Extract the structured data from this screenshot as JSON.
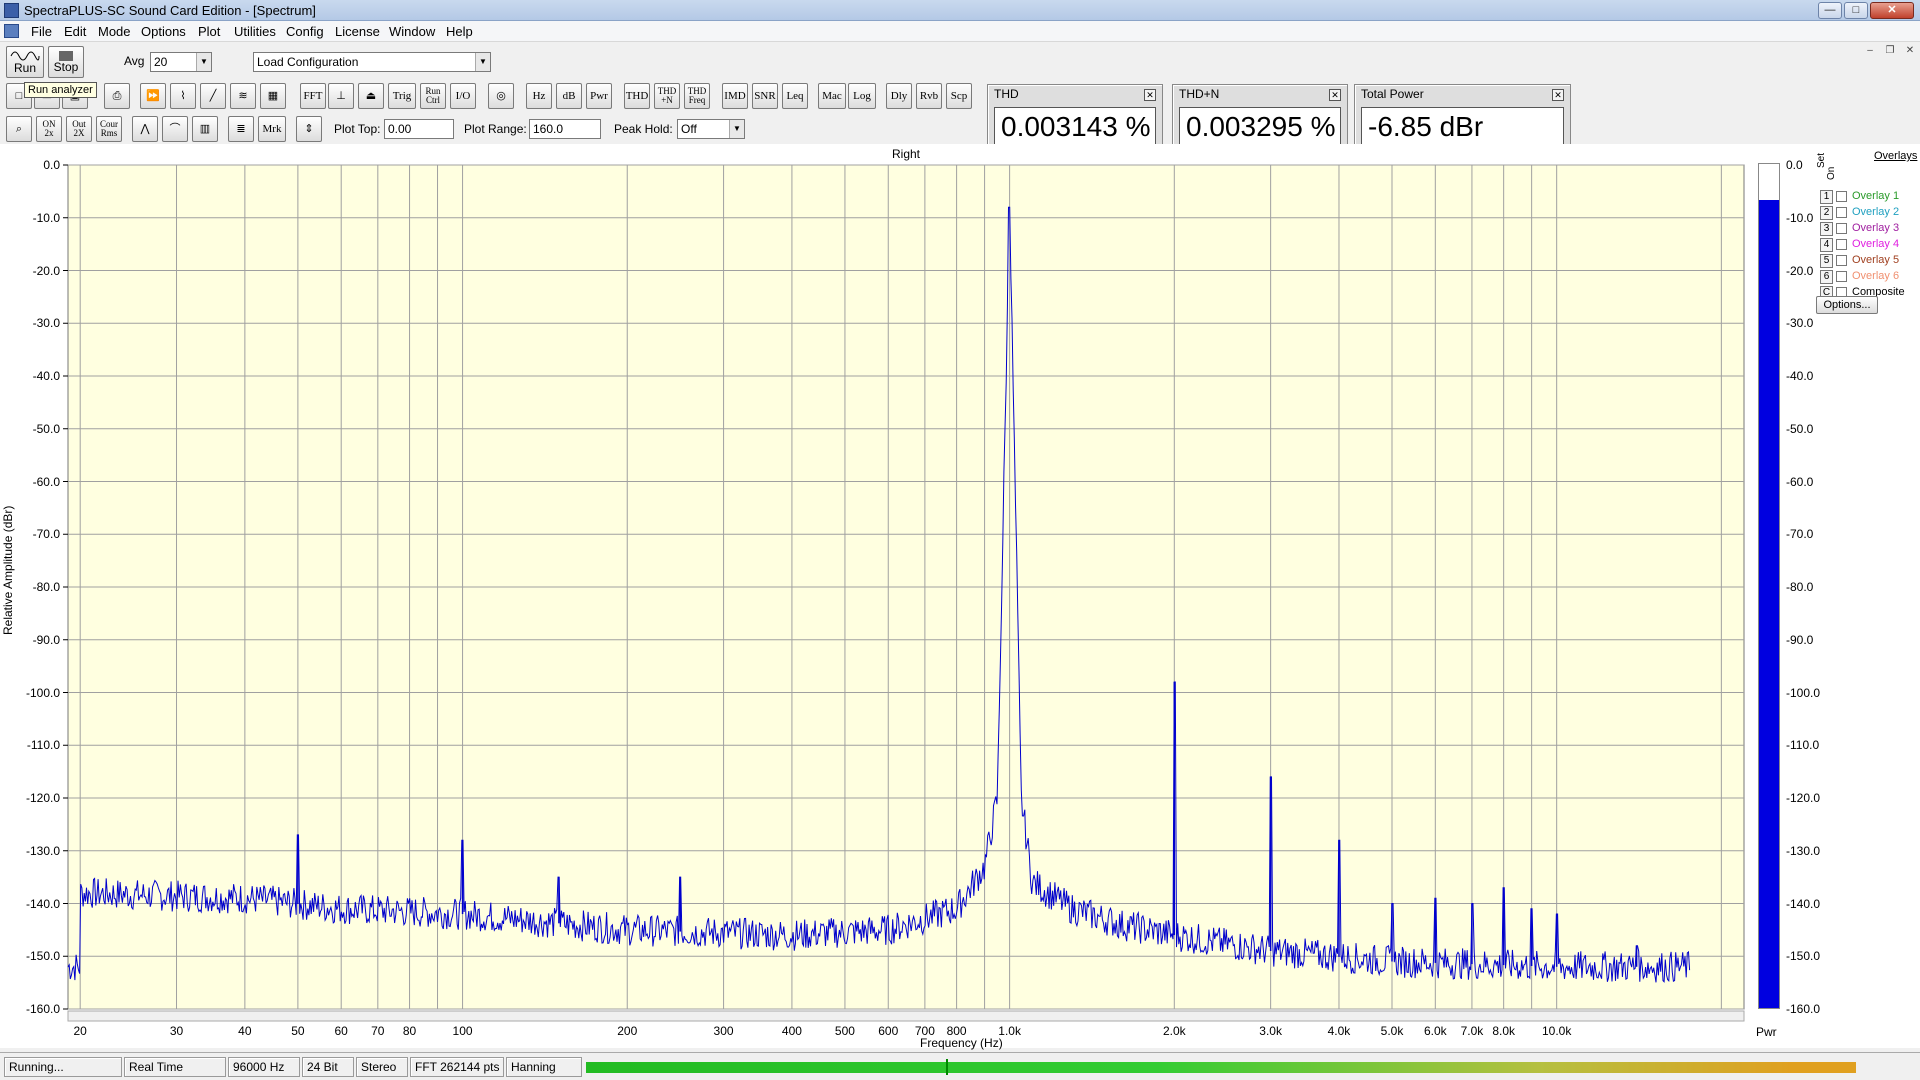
{
  "window": {
    "title": "SpectraPLUS-SC Sound Card Edition - [Spectrum]",
    "controls": [
      "—",
      "□",
      "✕"
    ],
    "mdi_controls": [
      "–",
      "❐",
      "✕"
    ]
  },
  "menu": [
    "File",
    "Edit",
    "Mode",
    "Options",
    "Plot",
    "Utilities",
    "Config",
    "License",
    "Window",
    "Help"
  ],
  "toolbar": {
    "run_label": "Run",
    "stop_label": "Stop",
    "tooltip": "Run analyzer",
    "avg_label": "Avg",
    "avg_value": "20",
    "config_value": "Load Configuration",
    "row2_buttons": [
      "FFT",
      "Trig",
      "Run Ctrl",
      "I/O",
      "Hz",
      "dB",
      "Pwr",
      "THD",
      "THD +N",
      "THD Freq",
      "IMD",
      "SNR",
      "Leq",
      "Mac",
      "Log",
      "Dly",
      "Rvb",
      "Scp"
    ],
    "row3_buttons": [
      "ON 2x",
      "Out 2X",
      "Cour Rms",
      "Mrk"
    ],
    "plot_top_label": "Plot Top:",
    "plot_top_value": "0.00",
    "plot_range_label": "Plot Range:",
    "plot_range_value": "160.0",
    "peak_hold_label": "Peak Hold:",
    "peak_hold_value": "Off"
  },
  "meters": [
    {
      "title": "THD",
      "value": "0.003143 %"
    },
    {
      "title": "THD+N",
      "value": "0.003295 %"
    },
    {
      "title": "Total Power",
      "value": "-6.85 dBr"
    }
  ],
  "plot": {
    "channel": "Right",
    "y_axis_label": "Relative Amplitude (dBr)",
    "x_axis_label": "Frequency (Hz)",
    "y_ticks": [
      "0.0",
      "-10.0",
      "-20.0",
      "-30.0",
      "-40.0",
      "-50.0",
      "-60.0",
      "-70.0",
      "-80.0",
      "-90.0",
      "-100.0",
      "-110.0",
      "-120.0",
      "-130.0",
      "-140.0",
      "-150.0",
      "-160.0"
    ],
    "x_ticks": [
      "20",
      "30",
      "40",
      "50",
      "60",
      "70",
      "80",
      "100",
      "200",
      "300",
      "400",
      "500",
      "600",
      "700",
      "800",
      "1.0k",
      "2.0k",
      "3.0k",
      "4.0k",
      "5.0k",
      "6.0k",
      "7.0k",
      "8.0k",
      "10.0k"
    ],
    "pwr_label": "Pwr",
    "colors": {
      "background": "#ffffe0",
      "grid": "#a0a0a0",
      "trace": "#0000cc"
    }
  },
  "chart_data": {
    "type": "line",
    "title": "Right",
    "xlabel": "Frequency (Hz)",
    "ylabel": "Relative Amplitude (dBr)",
    "x_scale": "log",
    "xlim": [
      19,
      22000
    ],
    "ylim": [
      -160,
      0
    ],
    "grid": true,
    "series": [
      {
        "noise_floor": [
          [
            20,
            -138
          ],
          [
            40,
            -139
          ],
          [
            60,
            -141
          ],
          [
            100,
            -142
          ],
          [
            200,
            -145
          ],
          [
            400,
            -146
          ],
          [
            600,
            -145
          ],
          [
            800,
            -141
          ],
          [
            900,
            -133
          ],
          [
            950,
            -120
          ],
          [
            1000,
            -8
          ],
          [
            1050,
            -120
          ],
          [
            1100,
            -136
          ],
          [
            1300,
            -141
          ],
          [
            1600,
            -144
          ],
          [
            2000,
            -146
          ],
          [
            3000,
            -149
          ],
          [
            5000,
            -151
          ],
          [
            10000,
            -152
          ],
          [
            20000,
            -152
          ]
        ],
        "peaks": [
          [
            50,
            -127
          ],
          [
            100,
            -128
          ],
          [
            150,
            -135
          ],
          [
            250,
            -135
          ],
          [
            1000,
            -8
          ],
          [
            2000,
            -98
          ],
          [
            3000,
            -116
          ],
          [
            4000,
            -128
          ],
          [
            5000,
            -140
          ],
          [
            6000,
            -139
          ],
          [
            7000,
            -140
          ],
          [
            8000,
            -137
          ],
          [
            9000,
            -141
          ],
          [
            10000,
            -142
          ],
          [
            14000,
            -148
          ]
        ]
      }
    ],
    "meter": {
      "label": "Pwr",
      "value_dbr": -6.85
    }
  },
  "overlays": {
    "title": "Overlays",
    "col_set": "Set",
    "col_on": "On",
    "items": [
      {
        "num": "1",
        "name": "Overlay 1",
        "color": "#2a9a2a"
      },
      {
        "num": "2",
        "name": "Overlay 2",
        "color": "#20a0c0"
      },
      {
        "num": "3",
        "name": "Overlay 3",
        "color": "#a020a0"
      },
      {
        "num": "4",
        "name": "Overlay 4",
        "color": "#e020e0"
      },
      {
        "num": "5",
        "name": "Overlay 5",
        "color": "#a04020"
      },
      {
        "num": "6",
        "name": "Overlay 6",
        "color": "#f09070"
      },
      {
        "num": "C",
        "name": "Composite",
        "color": "#000000"
      }
    ],
    "options_label": "Options..."
  },
  "status": {
    "state": "Running...",
    "mode": "Real Time",
    "rate": "96000 Hz",
    "bits": "24 Bit",
    "channels": "Stereo",
    "fft": "FFT 262144 pts",
    "window": "Hanning"
  }
}
